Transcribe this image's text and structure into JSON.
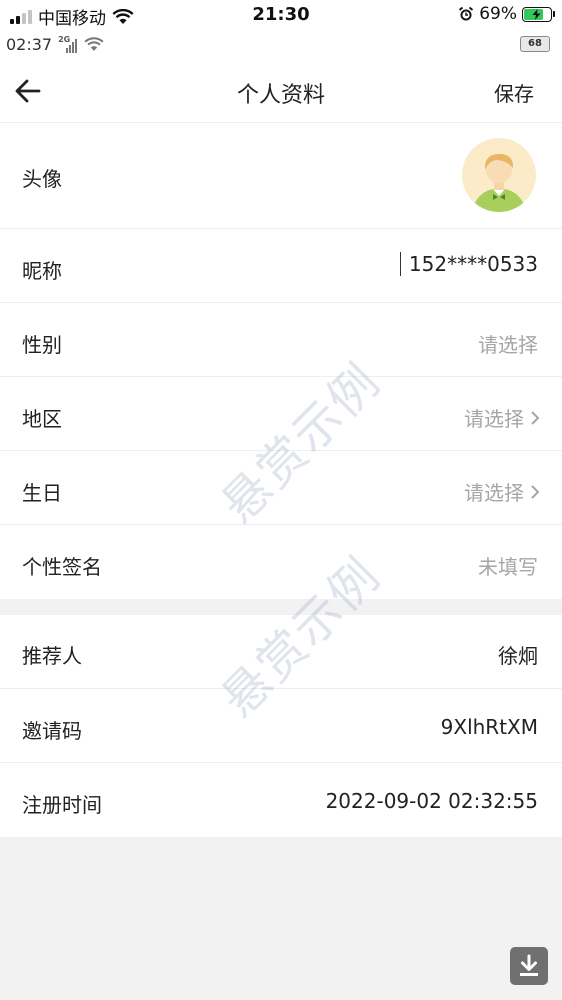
{
  "status_bar": {
    "carrier": "中国移动",
    "time": "21:30",
    "battery_percent": "69%",
    "battery_level": 0.69,
    "icons": [
      "signal-icon",
      "wifi-icon",
      "alarm-icon",
      "battery-icon"
    ]
  },
  "status_bar_secondary": {
    "time": "02:37",
    "network": "2G",
    "battery": "68"
  },
  "nav": {
    "title": "个人资料",
    "save_label": "保存",
    "back_icon": "back-arrow-icon"
  },
  "profile": {
    "avatar_label": "头像",
    "rows": [
      {
        "label": "昵称",
        "value": "152****0533",
        "placeholder": false,
        "chevron": false
      },
      {
        "label": "性别",
        "value": "请选择",
        "placeholder": true,
        "chevron": false
      },
      {
        "label": "地区",
        "value": "请选择",
        "placeholder": true,
        "chevron": true
      },
      {
        "label": "生日",
        "value": "请选择",
        "placeholder": true,
        "chevron": true
      },
      {
        "label": "个性签名",
        "value": "未填写",
        "placeholder": true,
        "chevron": false
      }
    ]
  },
  "info": {
    "rows": [
      {
        "label": "推荐人",
        "value": "徐炯"
      },
      {
        "label": "邀请码",
        "value": "9XlhRtXM"
      },
      {
        "label": "注册时间",
        "value": "2022-09-02 02:32:55"
      }
    ]
  },
  "watermark_text": "悬赏示例",
  "colors": {
    "background": "#f2f2f2",
    "panel": "#ffffff",
    "placeholder_text": "#a6a6a6",
    "battery_fill": "#34c759",
    "download_button": "#707070"
  }
}
